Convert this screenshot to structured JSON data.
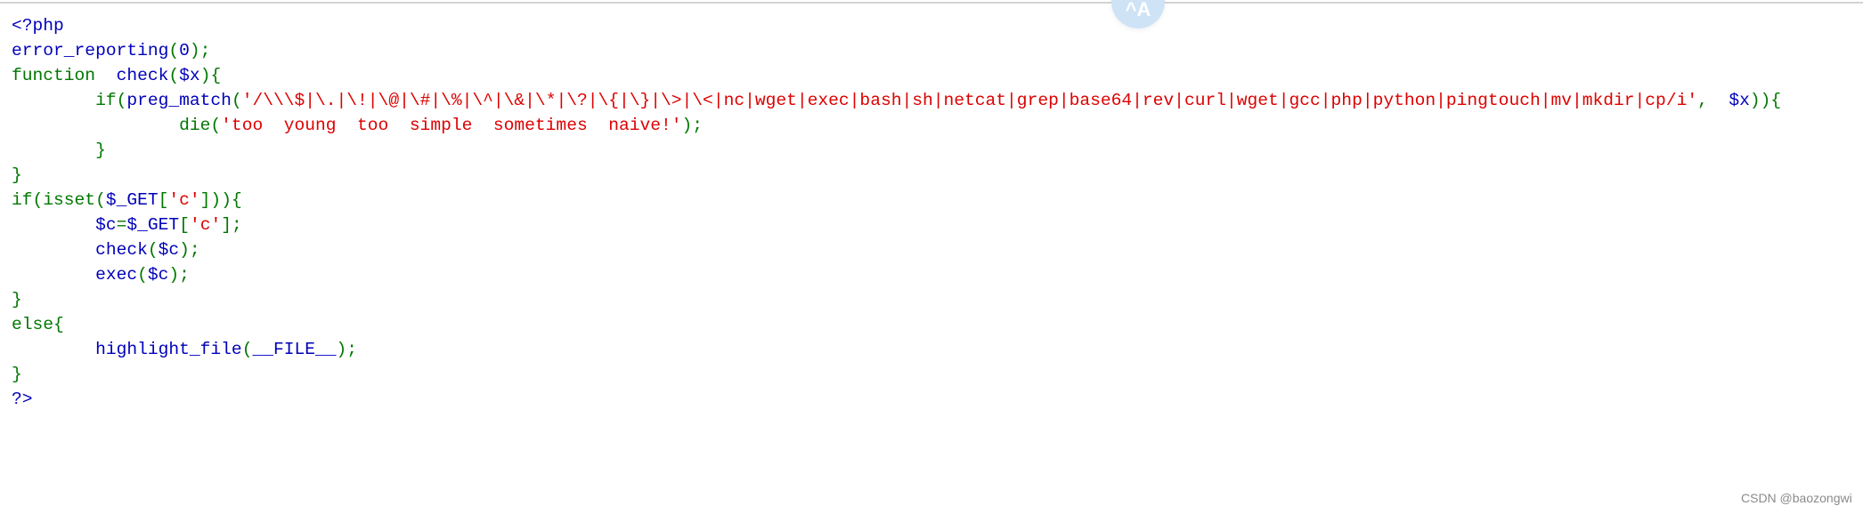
{
  "colors": {
    "keyword_default": "#0000BB",
    "keyword": "#007700",
    "string": "#DD0000"
  },
  "translate_bubble": {
    "icon": "translate-icon",
    "label": "^A"
  },
  "code_lines": [
    [
      {
        "t": "<?php",
        "c": "b"
      }
    ],
    [
      {
        "t": "error_reporting",
        "c": "b"
      },
      {
        "t": "(",
        "c": "g"
      },
      {
        "t": "0",
        "c": "b"
      },
      {
        "t": ");",
        "c": "g"
      }
    ],
    [
      {
        "t": "function  ",
        "c": "g"
      },
      {
        "t": "check",
        "c": "b"
      },
      {
        "t": "(",
        "c": "g"
      },
      {
        "t": "$x",
        "c": "b"
      },
      {
        "t": "){",
        "c": "g"
      }
    ],
    [
      {
        "t": "        if(",
        "c": "g"
      },
      {
        "t": "preg_match",
        "c": "b"
      },
      {
        "t": "(",
        "c": "g"
      },
      {
        "t": "'/\\\\\\$|\\.|\\!|\\@|\\#|\\%|\\^|\\&|\\*|\\?|\\{|\\}|\\>|\\<|nc|wget|exec|bash|sh|netcat|grep|base64|rev|curl|wget|gcc|php|python|pingtouch|mv|mkdir|cp/i'",
        "c": "r"
      },
      {
        "t": ",  ",
        "c": "g"
      },
      {
        "t": "$x",
        "c": "b"
      },
      {
        "t": ")){",
        "c": "g"
      }
    ],
    [
      {
        "t": "                die(",
        "c": "g"
      },
      {
        "t": "'too  young  too  simple  sometimes  naive!'",
        "c": "r"
      },
      {
        "t": ");",
        "c": "g"
      }
    ],
    [
      {
        "t": "        }",
        "c": "g"
      }
    ],
    [
      {
        "t": "}",
        "c": "g"
      }
    ],
    [
      {
        "t": "if(isset(",
        "c": "g"
      },
      {
        "t": "$_GET",
        "c": "b"
      },
      {
        "t": "[",
        "c": "g"
      },
      {
        "t": "'c'",
        "c": "r"
      },
      {
        "t": "])){",
        "c": "g"
      }
    ],
    [
      {
        "t": "        ",
        "c": "g"
      },
      {
        "t": "$c",
        "c": "b"
      },
      {
        "t": "=",
        "c": "g"
      },
      {
        "t": "$_GET",
        "c": "b"
      },
      {
        "t": "[",
        "c": "g"
      },
      {
        "t": "'c'",
        "c": "r"
      },
      {
        "t": "];",
        "c": "g"
      }
    ],
    [
      {
        "t": "        ",
        "c": "g"
      },
      {
        "t": "check",
        "c": "b"
      },
      {
        "t": "(",
        "c": "g"
      },
      {
        "t": "$c",
        "c": "b"
      },
      {
        "t": ");",
        "c": "g"
      }
    ],
    [
      {
        "t": "        ",
        "c": "g"
      },
      {
        "t": "exec",
        "c": "b"
      },
      {
        "t": "(",
        "c": "g"
      },
      {
        "t": "$c",
        "c": "b"
      },
      {
        "t": ");",
        "c": "g"
      }
    ],
    [
      {
        "t": "}",
        "c": "g"
      }
    ],
    [
      {
        "t": "else{",
        "c": "g"
      }
    ],
    [
      {
        "t": "        ",
        "c": "g"
      },
      {
        "t": "highlight_file",
        "c": "b"
      },
      {
        "t": "(",
        "c": "g"
      },
      {
        "t": "__FILE__",
        "c": "b"
      },
      {
        "t": ");",
        "c": "g"
      }
    ],
    [
      {
        "t": "}",
        "c": "g"
      }
    ],
    [
      {
        "t": "?>",
        "c": "b"
      }
    ]
  ],
  "watermark": "CSDN @baozongwi"
}
